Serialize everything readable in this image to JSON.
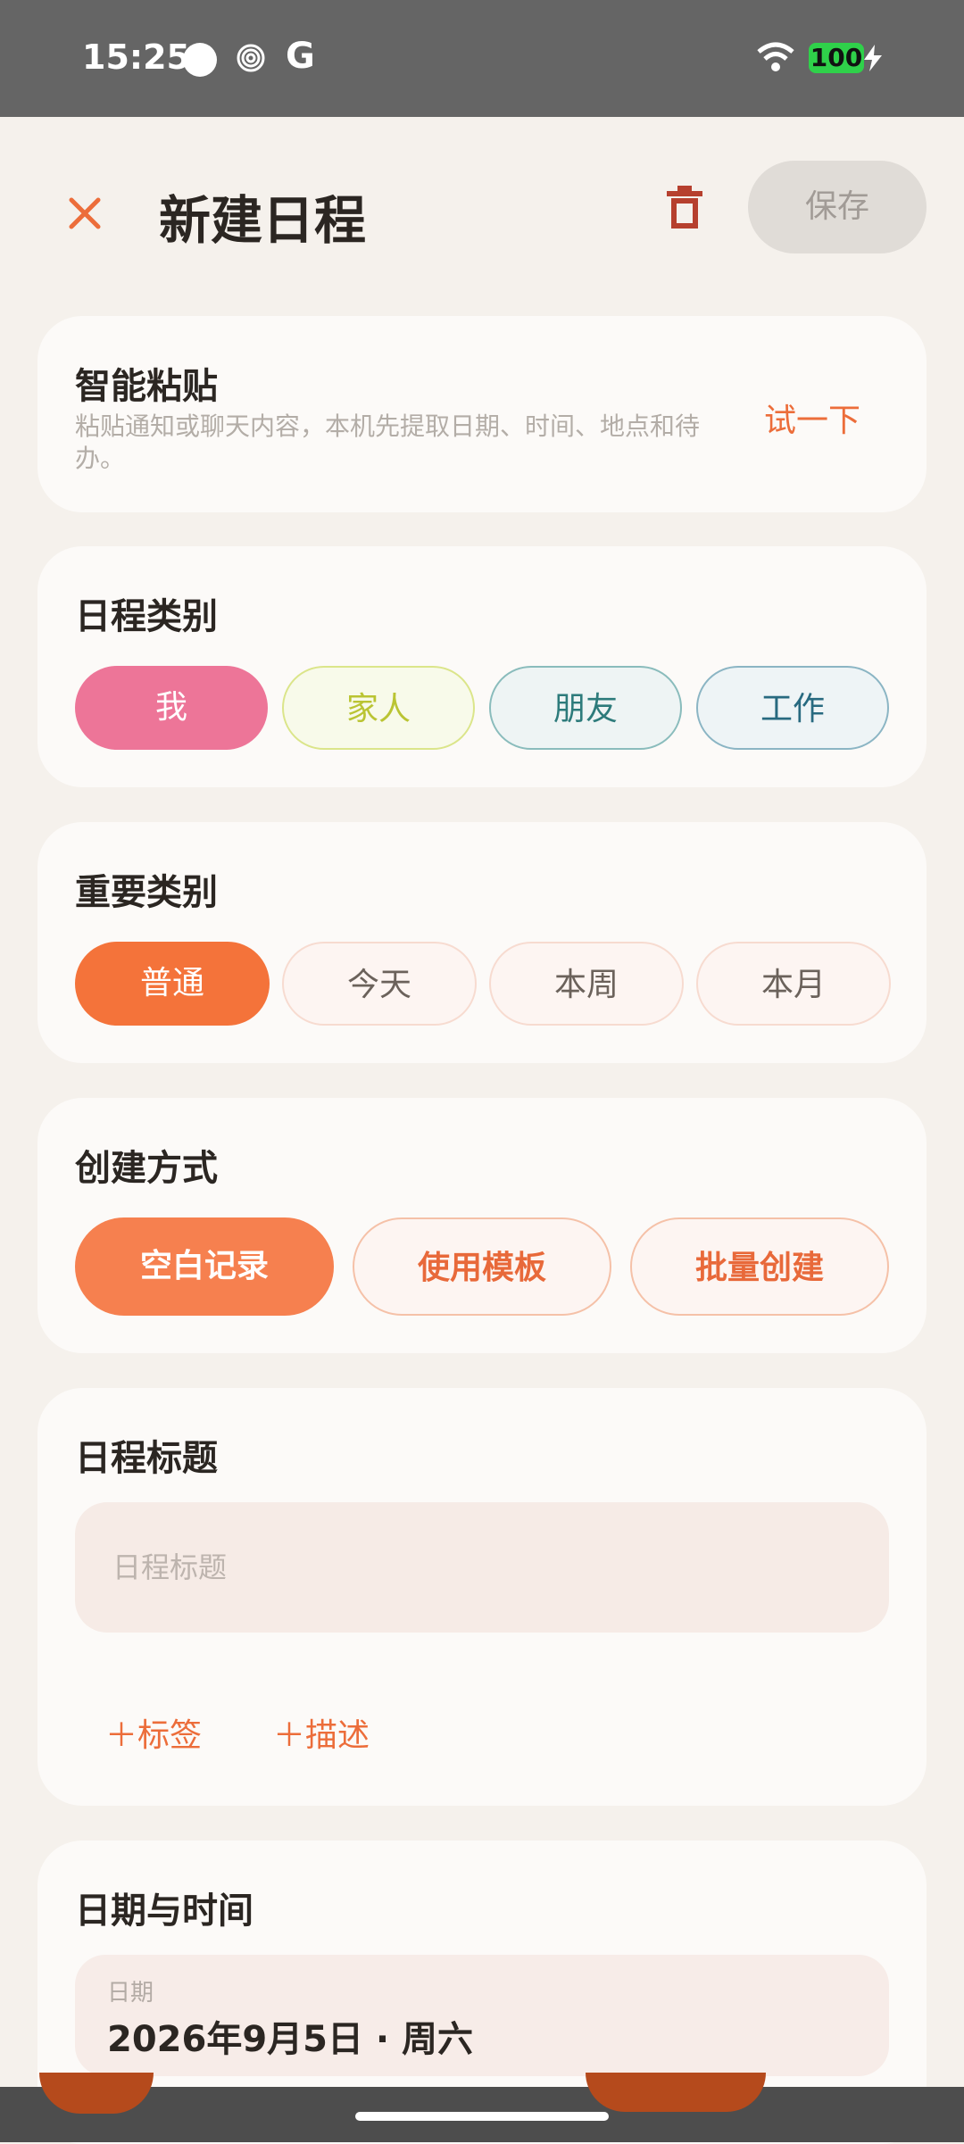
{
  "status_bar": {
    "time": "15:25",
    "google_glyph": "G",
    "battery": "100"
  },
  "header": {
    "title": "新建日程",
    "save_label": "保存"
  },
  "smart_paste": {
    "title": "智能粘贴",
    "description": "粘贴通知或聊天内容，本机先提取日期、时间、地点和待办。",
    "action": "试一下"
  },
  "category": {
    "title": "日程类别",
    "options": [
      "我",
      "家人",
      "朋友",
      "工作"
    ],
    "selected": "我"
  },
  "importance": {
    "title": "重要类别",
    "options": [
      "普通",
      "今天",
      "本周",
      "本月"
    ],
    "selected": "普通"
  },
  "create_mode": {
    "title": "创建方式",
    "options": [
      "空白记录",
      "使用模板",
      "批量创建"
    ],
    "selected": "空白记录"
  },
  "schedule_title": {
    "title": "日程标题",
    "placeholder": "日程标题",
    "value": "",
    "add_tag": "＋标签",
    "add_desc": "＋描述"
  },
  "datetime": {
    "title": "日期与时间",
    "date_label": "日期",
    "date_value": "2026年9月5日 · 周六"
  },
  "colors": {
    "accent": "#f4733a",
    "me": "#ed7598"
  }
}
